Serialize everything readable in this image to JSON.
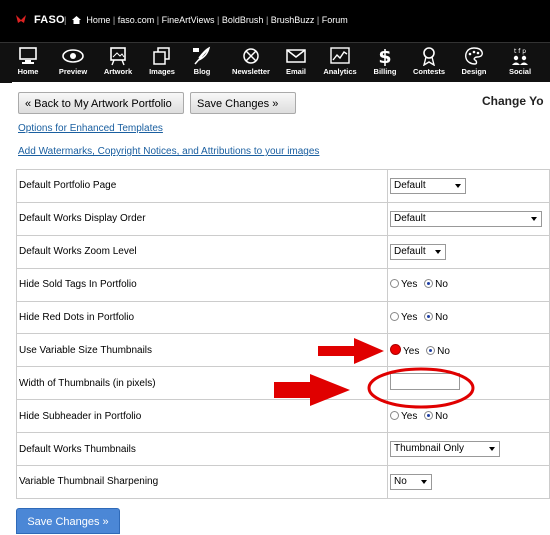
{
  "topbar": {
    "brand": "FASO",
    "links": [
      "Home",
      "faso.com",
      "FineArtViews",
      "BoldBrush",
      "BrushBuzz",
      "Forum"
    ],
    "separator": "|"
  },
  "nav": {
    "items": [
      {
        "label": "Home",
        "icon": "computer-icon"
      },
      {
        "label": "Preview",
        "icon": "eye-icon"
      },
      {
        "label": "Artwork",
        "icon": "easel-icon"
      },
      {
        "label": "Images",
        "icon": "images-icon"
      },
      {
        "label": "Blog",
        "icon": "quill-icon"
      },
      {
        "label": "Newsletter",
        "icon": "satellite-icon"
      },
      {
        "label": "Email",
        "icon": "envelope-icon"
      },
      {
        "label": "Analytics",
        "icon": "chart-icon"
      },
      {
        "label": "Billing",
        "icon": "dollar-icon"
      },
      {
        "label": "Contests",
        "icon": "ribbon-icon"
      },
      {
        "label": "Design",
        "icon": "palette-icon"
      },
      {
        "label": "Social",
        "icon": "social-icon"
      }
    ]
  },
  "toolbar": {
    "back_label": "« Back to My Artwork Portfolio",
    "save_label": "Save Changes »",
    "page_title": "Change Yo"
  },
  "links": {
    "enhanced": "Options for Enhanced Templates",
    "watermarks": "Add Watermarks, Copyright Notices, and Attributions to your images"
  },
  "settings": {
    "rows": [
      {
        "label": "Default Portfolio Page",
        "value": "Default"
      },
      {
        "label": "Default Works Display Order",
        "value": "Default"
      },
      {
        "label": "Default Works Zoom Level",
        "value": "Default"
      },
      {
        "label": "Hide Sold Tags In Portfolio",
        "yes": "Yes",
        "no": "No"
      },
      {
        "label": "Hide Red Dots in Portfolio",
        "yes": "Yes",
        "no": "No"
      },
      {
        "label": "Use Variable Size Thumbnails",
        "yes": "Yes",
        "no": "No"
      },
      {
        "label": "Width of Thumbnails (in pixels)",
        "value": ""
      },
      {
        "label": "Hide Subheader in Portfolio",
        "yes": "Yes",
        "no": "No"
      },
      {
        "label": "Default Works Thumbnails",
        "value": "Thumbnail Only"
      },
      {
        "label": "Variable Thumbnail Sharpening",
        "value": "No"
      }
    ]
  },
  "footer": {
    "save_label": "Save Changes »"
  },
  "colors": {
    "accent": "#4b87d6",
    "annotation": "#e00000",
    "link": "#1a5fa0"
  }
}
